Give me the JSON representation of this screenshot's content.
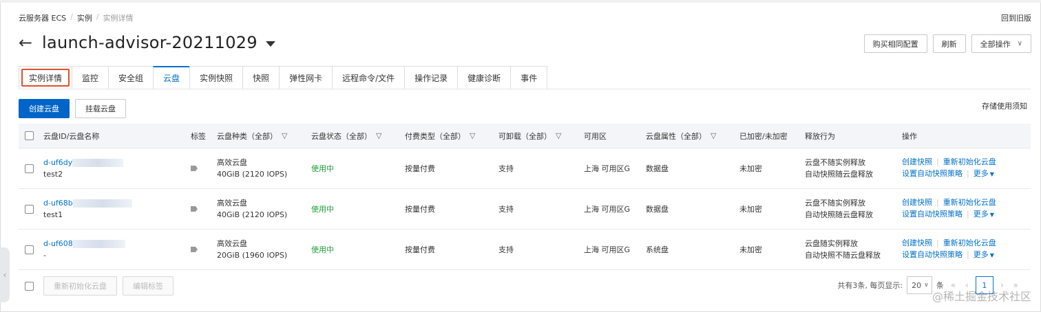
{
  "breadcrumb": [
    "云服务器 ECS",
    "实例",
    "实例详情"
  ],
  "back_old_label": "回到旧版",
  "title": "launch-advisor-20211029",
  "top_actions": {
    "buy_same": "购买相同配置",
    "refresh": "刷新",
    "all_ops": "全部操作"
  },
  "tabs": [
    "实例详情",
    "监控",
    "安全组",
    "云盘",
    "实例快照",
    "快照",
    "弹性网卡",
    "远程命令/文件",
    "操作记录",
    "健康诊断",
    "事件"
  ],
  "active_tab": "云盘",
  "toolbar": {
    "create_disk": "创建云盘",
    "attach_disk": "挂载云盘",
    "storage_notice": "存储使用须知"
  },
  "columns": {
    "id_name": "云盘ID/云盘名称",
    "tags": "标签",
    "disk_type": "云盘种类（全部）",
    "status": "云盘状态（全部）",
    "billing": "付费类型（全部）",
    "detachable": "可卸载（全部）",
    "zone": "可用区",
    "attribute": "云盘属性（全部）",
    "encrypted": "已加密/未加密",
    "release": "释放行为",
    "ops": "操作"
  },
  "rows": [
    {
      "id": "d-uf6dy",
      "name": "test2",
      "type": "高效云盘",
      "spec": "40GiB (2120 IOPS)",
      "status": "使用中",
      "billing": "按量付费",
      "detachable": "支持",
      "zone": "上海 可用区G",
      "attribute": "数据盘",
      "encrypted": "未加密",
      "release1": "云盘不随实例释放",
      "release2": "自动快照随云盘释放",
      "op_snapshot": "创建快照",
      "op_reinit": "重新初始化云盘",
      "op_auto": "设置自动快照策略",
      "op_more": "更多"
    },
    {
      "id": "d-uf68b",
      "name": "test1",
      "type": "高效云盘",
      "spec": "40GiB (2120 IOPS)",
      "status": "使用中",
      "billing": "按量付费",
      "detachable": "支持",
      "zone": "上海 可用区G",
      "attribute": "数据盘",
      "encrypted": "未加密",
      "release1": "云盘不随实例释放",
      "release2": "自动快照随云盘释放",
      "op_snapshot": "创建快照",
      "op_reinit": "重新初始化云盘",
      "op_auto": "设置自动快照策略",
      "op_more": "更多"
    },
    {
      "id": "d-uf608",
      "name": "-",
      "type": "高效云盘",
      "spec": "20GiB (1960 IOPS)",
      "status": "使用中",
      "billing": "按量付费",
      "detachable": "支持",
      "zone": "上海 可用区G",
      "attribute": "系统盘",
      "encrypted": "未加密",
      "release1": "云盘随实例释放",
      "release2": "自动快照不随云盘释放",
      "op_snapshot": "创建快照",
      "op_reinit": "重新初始化云盘",
      "op_auto": "设置自动快照策略",
      "op_more": "更多"
    }
  ],
  "footer": {
    "reinit_btn": "重新初始化云盘",
    "edit_tags_btn": "编辑标签",
    "total_text": "共有3条, 每页显示:",
    "page_size": "20",
    "per_unit": "条",
    "current_page": "1"
  },
  "watermark": "@稀土掘金技术社区",
  "colors": {
    "primary": "#0064c8",
    "link": "#0070cc",
    "status_green": "#1ca035",
    "highlight_box": "#e0502a"
  }
}
